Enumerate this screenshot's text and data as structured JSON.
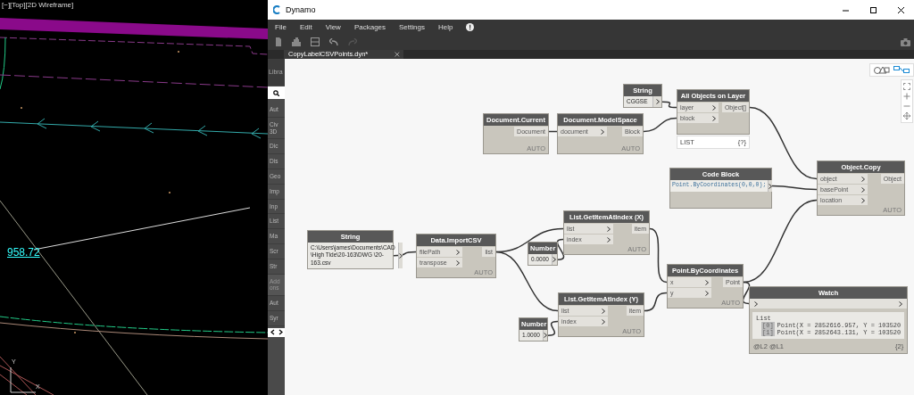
{
  "cad_view": {
    "viewport_label": "[−][Top][2D Wireframe]",
    "dimension_text": "958.72",
    "ucs_labels": [
      "Y",
      "X"
    ]
  },
  "window": {
    "title": "Dynamo"
  },
  "menu": [
    "File",
    "Edit",
    "View",
    "Packages",
    "Settings",
    "Help"
  ],
  "toolbar": {
    "redo_disabled": true
  },
  "tab": {
    "label": "CopyLabelCSVPoints.dyn*",
    "selected": true
  },
  "library": {
    "header": "Libra",
    "items": [
      "Aut",
      "Civ 3D",
      "Dic",
      "Dis",
      "Geo",
      "Imp",
      "Inp",
      "List",
      "Ma",
      "Scr",
      "Str",
      "Add ons",
      "Aut",
      "Syr"
    ]
  },
  "view_toggle": {
    "graph_selected": true
  },
  "nodes": [
    {
      "kind": "input",
      "title": "String",
      "value": "CGGSE"
    },
    {
      "kind": "function",
      "title": "All Objects on Layer",
      "inputs": [
        "layer",
        "block"
      ],
      "outputs": [
        "Object[]"
      ],
      "preview": {
        "label": "LIST",
        "count": "{?}"
      }
    },
    {
      "kind": "function",
      "title": "Document.Current",
      "outputs": [
        "Document"
      ],
      "lacing": "AUTO"
    },
    {
      "kind": "function",
      "title": "Document.ModelSpace",
      "inputs": [
        "document"
      ],
      "outputs": [
        "Block"
      ],
      "lacing": "AUTO"
    },
    {
      "kind": "code",
      "title": "Code Block",
      "code": "Point.ByCoordinates(0,0,0);"
    },
    {
      "kind": "function",
      "title": "Object.Copy",
      "inputs": [
        "object",
        "basePoint",
        "location"
      ],
      "outputs": [
        "Object"
      ],
      "lacing": "AUTO"
    },
    {
      "kind": "input",
      "title": "String",
      "value": "C:\\Users\\james\\Documents\\CAD \\High Tide\\20-163\\DWG \\20-163.csv"
    },
    {
      "kind": "function",
      "title": "Data.ImportCSV",
      "inputs": [
        "filePath",
        "transpose"
      ],
      "outputs": [
        "list"
      ],
      "lacing": "AUTO"
    },
    {
      "kind": "function",
      "title": "List.GetItemAtIndex (X)",
      "inputs": [
        "list",
        "index"
      ],
      "outputs": [
        "item"
      ],
      "lacing": "AUTO"
    },
    {
      "kind": "input",
      "title": "Number",
      "value": "0.0000"
    },
    {
      "kind": "function",
      "title": "List.GetItemAtIndex (Y)",
      "inputs": [
        "list",
        "index"
      ],
      "outputs": [
        "item"
      ],
      "lacing": "AUTO"
    },
    {
      "kind": "input",
      "title": "Number",
      "value": "1.0000"
    },
    {
      "kind": "function",
      "title": "Point.ByCoordinates",
      "inputs": [
        "x",
        "y"
      ],
      "outputs": [
        "Point"
      ],
      "lacing": "AUTO"
    },
    {
      "kind": "watch",
      "title": "Watch",
      "list_label": "List",
      "items": [
        {
          "index": "[0]",
          "text": "Point(X = 2852616.957, Y = 103520"
        },
        {
          "index": "[1]",
          "text": "Point(X = 2852643.131, Y = 103520"
        }
      ],
      "levels": "@L2 @L1",
      "count": "{2}"
    }
  ]
}
